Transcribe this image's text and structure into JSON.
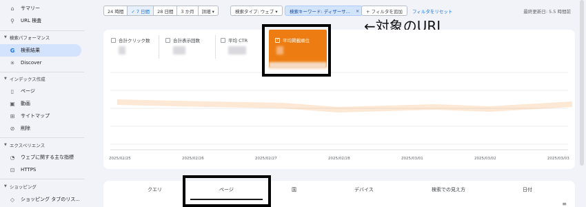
{
  "sidebar": {
    "items_top": [
      {
        "icon": "home-icon",
        "glyph": "⌂",
        "label": "サマリー"
      },
      {
        "icon": "search-icon",
        "glyph": "⚲",
        "label": "URL 検査"
      }
    ],
    "sections": [
      {
        "title": "検索パフォーマンス",
        "items": [
          {
            "icon": "google-g-icon",
            "glyph": "G",
            "label": "検索結果",
            "active": true
          },
          {
            "icon": "discover-icon",
            "glyph": "✳",
            "label": "Discover"
          }
        ]
      },
      {
        "title": "インデックス作成",
        "items": [
          {
            "icon": "page-icon",
            "glyph": "▯",
            "label": "ページ"
          },
          {
            "icon": "video-icon",
            "glyph": "▣",
            "label": "動画"
          },
          {
            "icon": "sitemap-icon",
            "glyph": "⊞",
            "label": "サイトマップ"
          },
          {
            "icon": "removal-icon",
            "glyph": "⊘",
            "label": "削除"
          }
        ]
      },
      {
        "title": "エクスペリエンス",
        "items": [
          {
            "icon": "web-vitals-icon",
            "glyph": "◔",
            "label": "ウェブに関する主な指標"
          },
          {
            "icon": "lock-icon",
            "glyph": "🔒",
            "label": "HTTPS"
          }
        ]
      },
      {
        "title": "ショッピング",
        "items": [
          {
            "icon": "tag-icon",
            "glyph": "◇",
            "label": "ショッピング タブのリス..."
          }
        ]
      }
    ]
  },
  "filters": {
    "date_ranges": [
      "24 時間",
      "✓ 7 日間",
      "28 日間",
      "3 か月",
      "詳細 ▾"
    ],
    "active_range_index": 1,
    "search_type": "検索タイプ: ウェブ ▾",
    "keyword_filter": "検索キーワード: ディザーサ...",
    "keyword_filter_close": "×",
    "add_filter": "+ フィルタを追加",
    "reset": "フィルタをリセット",
    "last_updated": "最終更新日: 5.5 時間前"
  },
  "annotation": "←対象のURL",
  "metrics": [
    {
      "label": "合計クリック数",
      "checked": false
    },
    {
      "label": "合計表示回数",
      "checked": false
    },
    {
      "label": "平均 CTR",
      "checked": false
    },
    {
      "label": "平均掲載順位",
      "checked": true,
      "color": "#ed7d12"
    }
  ],
  "chart_data": {
    "type": "line",
    "x": [
      "2025/02/25",
      "2025/02/26",
      "2025/02/27",
      "2025/02/28",
      "2025/03/01",
      "2025/03/02",
      "2025/03/03"
    ],
    "series": [
      {
        "values": [
          null,
          null,
          null,
          null,
          null,
          null,
          null
        ],
        "color": "#ed7d12"
      }
    ],
    "grid": true
  },
  "tabs": [
    "クエリ",
    "ページ",
    "国",
    "デバイス",
    "検索での見え方",
    "日付"
  ],
  "active_tab_index": 1
}
